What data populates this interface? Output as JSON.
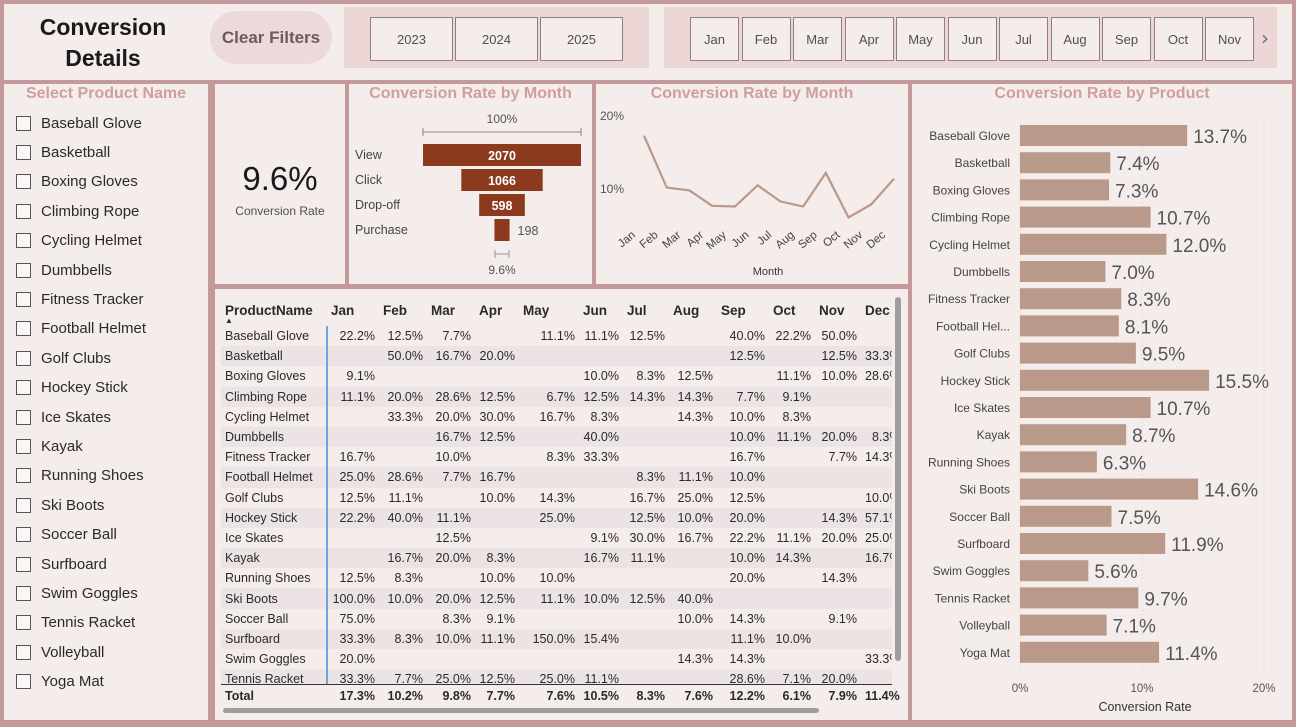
{
  "header": {
    "title": "Conversion Details",
    "clear_filters": "Clear Filters",
    "years": [
      "2023",
      "2024",
      "2025"
    ],
    "months": [
      "Jan",
      "Feb",
      "Mar",
      "Apr",
      "May",
      "Jun",
      "Jul",
      "Aug",
      "Sep",
      "Oct",
      "Nov"
    ],
    "next_icon": "chevron-right-icon"
  },
  "slicer": {
    "title": "Select Product Name",
    "items": [
      "Baseball Glove",
      "Basketball",
      "Boxing Gloves",
      "Climbing Rope",
      "Cycling Helmet",
      "Dumbbells",
      "Fitness Tracker",
      "Football Helmet",
      "Golf Clubs",
      "Hockey Stick",
      "Ice Skates",
      "Kayak",
      "Running Shoes",
      "Ski Boots",
      "Soccer Ball",
      "Surfboard",
      "Swim Goggles",
      "Tennis Racket",
      "Volleyball",
      "Yoga Mat"
    ]
  },
  "kpi": {
    "value": "9.6%",
    "label": "Conversion Rate"
  },
  "funnel": {
    "title": "Conversion Rate by Month",
    "top_label": "100%",
    "bottom_label": "9.6%",
    "stages": [
      {
        "label": "View",
        "value": 2070,
        "value_text": "2070"
      },
      {
        "label": "Click",
        "value": 1066,
        "value_text": "1066"
      },
      {
        "label": "Drop-off",
        "value": 598,
        "value_text": "598"
      },
      {
        "label": "Purchase",
        "value": 198,
        "value_text": "198"
      }
    ],
    "color": "#8b3a1e"
  },
  "line_chart": {
    "title": "Conversion Rate by Month",
    "y_ticks": [
      "20%",
      "10%"
    ],
    "xlabel": "Month"
  },
  "bar_chart": {
    "title": "Conversion Rate by Product",
    "xlabel": "Conversion Rate",
    "x_ticks": [
      "0%",
      "10%",
      "20%"
    ],
    "labels": [
      "Baseball Glove",
      "Basketball",
      "Boxing Gloves",
      "Climbing Rope",
      "Cycling Helmet",
      "Dumbbells",
      "Fitness Tracker",
      "Football Hel...",
      "Golf Clubs",
      "Hockey Stick",
      "Ice Skates",
      "Kayak",
      "Running Shoes",
      "Ski Boots",
      "Soccer Ball",
      "Surfboard",
      "Swim Goggles",
      "Tennis Racket",
      "Volleyball",
      "Yoga Mat"
    ],
    "value_labels": [
      "13.7%",
      "7.4%",
      "7.3%",
      "10.7%",
      "12.0%",
      "7.0%",
      "8.3%",
      "8.1%",
      "9.5%",
      "15.5%",
      "10.7%",
      "8.7%",
      "6.3%",
      "14.6%",
      "7.5%",
      "11.9%",
      "5.6%",
      "9.7%",
      "7.1%",
      "11.4%"
    ],
    "color": "#b8998a"
  },
  "chart_data": [
    {
      "type": "line",
      "title": "Conversion Rate by Month",
      "xlabel": "Month",
      "ylabel": "",
      "categories": [
        "Jan",
        "Feb",
        "Mar",
        "Apr",
        "May",
        "Jun",
        "Jul",
        "Aug",
        "Sep",
        "Oct",
        "Nov",
        "Dec"
      ],
      "values": [
        17.3,
        10.2,
        9.8,
        7.7,
        7.6,
        10.5,
        8.3,
        7.6,
        12.2,
        6.1,
        7.9,
        11.4
      ],
      "ylim": [
        0,
        20
      ],
      "grid": false,
      "color": "#b8998a"
    },
    {
      "type": "bar",
      "title": "Conversion Rate by Product",
      "xlabel": "Conversion Rate",
      "ylabel": "",
      "categories": [
        "Baseball Glove",
        "Basketball",
        "Boxing Gloves",
        "Climbing Rope",
        "Cycling Helmet",
        "Dumbbells",
        "Fitness Tracker",
        "Football Hel...",
        "Golf Clubs",
        "Hockey Stick",
        "Ice Skates",
        "Kayak",
        "Running Shoes",
        "Ski Boots",
        "Soccer Ball",
        "Surfboard",
        "Swim Goggles",
        "Tennis Racket",
        "Volleyball",
        "Yoga Mat"
      ],
      "values": [
        13.7,
        7.4,
        7.3,
        10.7,
        12.0,
        7.0,
        8.3,
        8.1,
        9.5,
        15.5,
        10.7,
        8.7,
        6.3,
        14.6,
        7.5,
        11.9,
        5.6,
        9.7,
        7.1,
        11.4
      ],
      "xlim": [
        0,
        20
      ],
      "orientation": "horizontal"
    }
  ],
  "matrix": {
    "row_header": "ProductName",
    "columns": [
      "Jan",
      "Feb",
      "Mar",
      "Apr",
      "May",
      "Jun",
      "Jul",
      "Aug",
      "Sep",
      "Oct",
      "Nov",
      "Dec"
    ],
    "rows": [
      [
        "Baseball Glove",
        "22.2%",
        "12.5%",
        "7.7%",
        "",
        "11.1%",
        "11.1%",
        "12.5%",
        "",
        "40.0%",
        "22.2%",
        "50.0%",
        ""
      ],
      [
        "Basketball",
        "",
        "50.0%",
        "16.7%",
        "20.0%",
        "",
        "",
        "",
        "",
        "12.5%",
        "",
        "12.5%",
        "33.3%"
      ],
      [
        "Boxing Gloves",
        "9.1%",
        "",
        "",
        "",
        "",
        "10.0%",
        "8.3%",
        "12.5%",
        "",
        "11.1%",
        "10.0%",
        "28.6%"
      ],
      [
        "Climbing Rope",
        "11.1%",
        "20.0%",
        "28.6%",
        "12.5%",
        "6.7%",
        "12.5%",
        "14.3%",
        "14.3%",
        "7.7%",
        "9.1%",
        "",
        ""
      ],
      [
        "Cycling Helmet",
        "",
        "33.3%",
        "20.0%",
        "30.0%",
        "16.7%",
        "8.3%",
        "",
        "14.3%",
        "10.0%",
        "8.3%",
        "",
        ""
      ],
      [
        "Dumbbells",
        "",
        "",
        "16.7%",
        "12.5%",
        "",
        "40.0%",
        "",
        "",
        "10.0%",
        "11.1%",
        "20.0%",
        "8.3%"
      ],
      [
        "Fitness Tracker",
        "16.7%",
        "",
        "10.0%",
        "",
        "8.3%",
        "33.3%",
        "",
        "",
        "16.7%",
        "",
        "7.7%",
        "14.3%"
      ],
      [
        "Football Helmet",
        "25.0%",
        "28.6%",
        "7.7%",
        "16.7%",
        "",
        "",
        "8.3%",
        "11.1%",
        "10.0%",
        "",
        "",
        ""
      ],
      [
        "Golf Clubs",
        "12.5%",
        "11.1%",
        "",
        "10.0%",
        "14.3%",
        "",
        "16.7%",
        "25.0%",
        "12.5%",
        "",
        "",
        "10.0%"
      ],
      [
        "Hockey Stick",
        "22.2%",
        "40.0%",
        "11.1%",
        "",
        "25.0%",
        "",
        "12.5%",
        "10.0%",
        "20.0%",
        "",
        "14.3%",
        "57.1%"
      ],
      [
        "Ice Skates",
        "",
        "",
        "12.5%",
        "",
        "",
        "9.1%",
        "30.0%",
        "16.7%",
        "22.2%",
        "11.1%",
        "20.0%",
        "25.0%"
      ],
      [
        "Kayak",
        "",
        "16.7%",
        "20.0%",
        "8.3%",
        "",
        "16.7%",
        "11.1%",
        "",
        "10.0%",
        "14.3%",
        "",
        "16.7%"
      ],
      [
        "Running Shoes",
        "12.5%",
        "8.3%",
        "",
        "10.0%",
        "10.0%",
        "",
        "",
        "",
        "20.0%",
        "",
        "14.3%",
        ""
      ],
      [
        "Ski Boots",
        "100.0%",
        "10.0%",
        "20.0%",
        "12.5%",
        "11.1%",
        "10.0%",
        "12.5%",
        "40.0%",
        "",
        "",
        "",
        ""
      ],
      [
        "Soccer Ball",
        "75.0%",
        "",
        "8.3%",
        "9.1%",
        "",
        "",
        "",
        "10.0%",
        "14.3%",
        "",
        "9.1%",
        ""
      ],
      [
        "Surfboard",
        "33.3%",
        "8.3%",
        "10.0%",
        "11.1%",
        "150.0%",
        "15.4%",
        "",
        "",
        "11.1%",
        "10.0%",
        "",
        ""
      ],
      [
        "Swim Goggles",
        "20.0%",
        "",
        "",
        "",
        "",
        "",
        "",
        "14.3%",
        "14.3%",
        "",
        "",
        "33.3%"
      ],
      [
        "Tennis Racket",
        "33.3%",
        "7.7%",
        "25.0%",
        "12.5%",
        "25.0%",
        "11.1%",
        "",
        "",
        "28.6%",
        "7.1%",
        "20.0%",
        ""
      ]
    ],
    "total": [
      "Total",
      "17.3%",
      "10.2%",
      "9.8%",
      "7.7%",
      "7.6%",
      "10.5%",
      "8.3%",
      "7.6%",
      "12.2%",
      "6.1%",
      "7.9%",
      "11.4%"
    ]
  }
}
